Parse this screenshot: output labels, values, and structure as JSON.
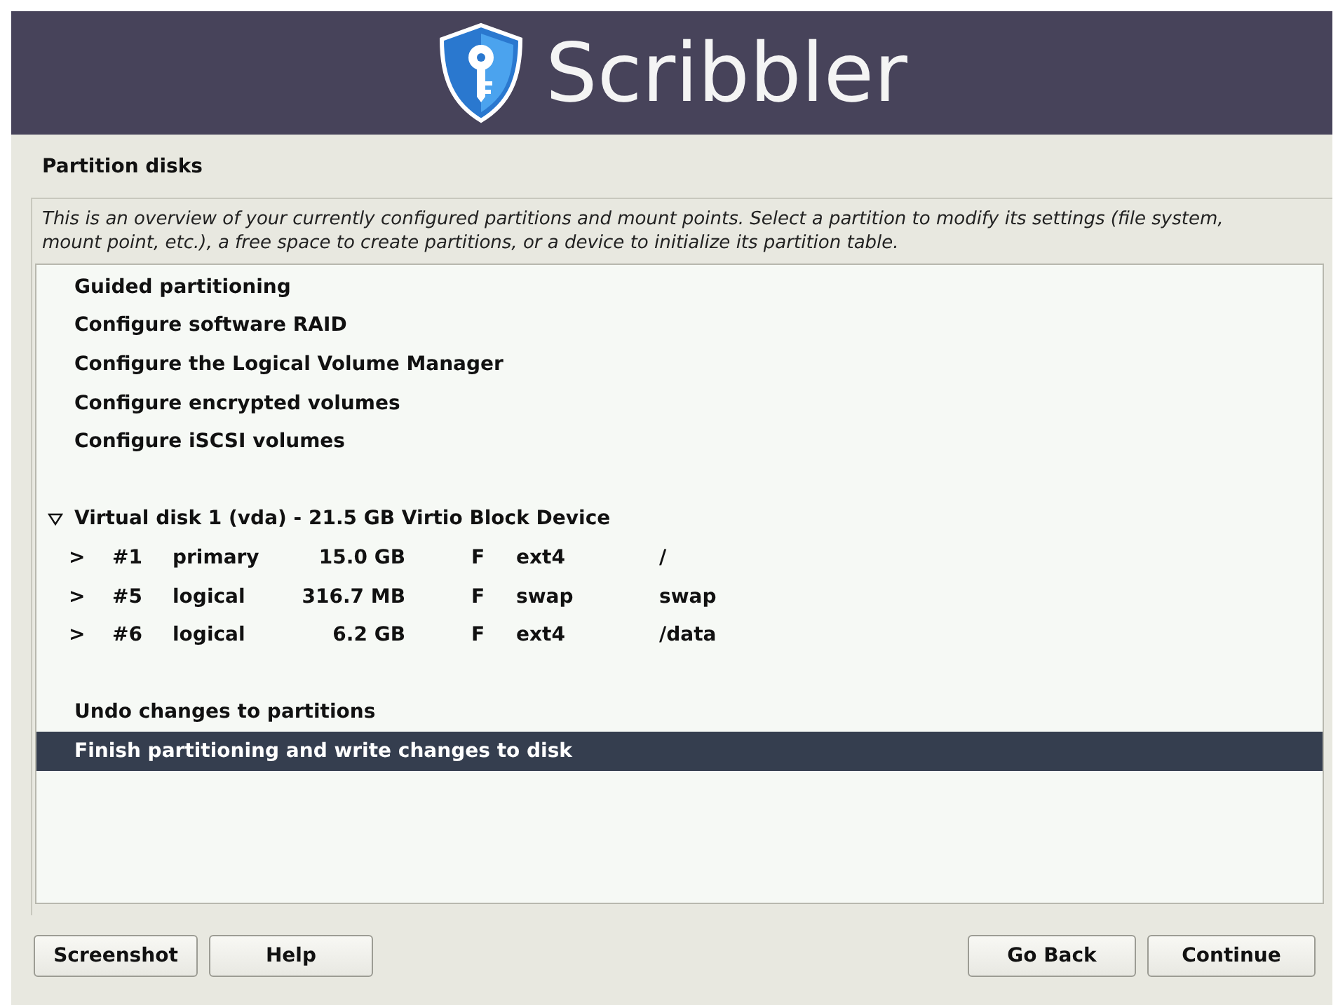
{
  "header": {
    "title": "Scribbler"
  },
  "page_title": "Partition disks",
  "description": "This is an overview of your currently configured partitions and mount points. Select a partition to modify its settings (file system, mount point, etc.), a free space to create partitions, or a device to initialize its partition table.",
  "items": [
    {
      "kind": "action",
      "label": "Guided partitioning",
      "selected": false
    },
    {
      "kind": "action",
      "label": "Configure software RAID",
      "selected": false
    },
    {
      "kind": "action",
      "label": "Configure the Logical Volume Manager",
      "selected": false
    },
    {
      "kind": "action",
      "label": "Configure encrypted volumes",
      "selected": false
    },
    {
      "kind": "action",
      "label": "Configure iSCSI volumes",
      "selected": false
    },
    {
      "kind": "blank"
    },
    {
      "kind": "disk",
      "label": "Virtual disk 1 (vda) - 21.5 GB Virtio Block Device",
      "expanded": true,
      "selected": false
    },
    {
      "kind": "partition",
      "marker": ">",
      "number": "#1",
      "type": "primary",
      "size": "15.0 GB",
      "flag": "F",
      "filesystem": "ext4",
      "mount": "/",
      "selected": false
    },
    {
      "kind": "partition",
      "marker": ">",
      "number": "#5",
      "type": "logical",
      "size": "316.7 MB",
      "flag": "F",
      "filesystem": "swap",
      "mount": "swap",
      "selected": false
    },
    {
      "kind": "partition",
      "marker": ">",
      "number": "#6",
      "type": "logical",
      "size": "6.2 GB",
      "flag": "F",
      "filesystem": "ext4",
      "mount": "/data",
      "selected": false
    },
    {
      "kind": "blank"
    },
    {
      "kind": "action",
      "label": "Undo changes to partitions",
      "selected": false
    },
    {
      "kind": "action",
      "label": "Finish partitioning and write changes to disk",
      "selected": true
    }
  ],
  "buttons_left": [
    "Screenshot",
    "Help"
  ],
  "buttons_right": [
    "Go Back",
    "Continue"
  ]
}
